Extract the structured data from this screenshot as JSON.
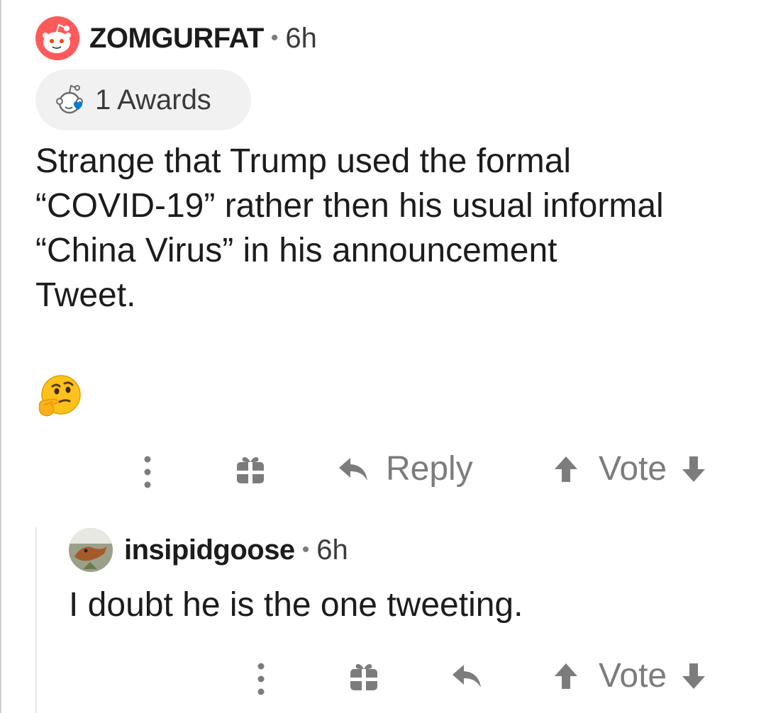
{
  "parent": {
    "username": "ZOMGURFAT",
    "separator": "•",
    "time": "6h",
    "awards_label": "1 Awards",
    "body": "Strange that Trump used the formal\n“COVID-19” rather then his usual informal\n“China Virus” in his announcement\nTweet.",
    "emoji": "thinking-face",
    "actions": {
      "more": "more-options",
      "gift": "award-gift",
      "reply_label": "Reply",
      "vote_label": "Vote"
    }
  },
  "reply": {
    "username": "insipidgoose",
    "separator": "•",
    "time": "6h",
    "body": "I doubt he is the one tweeting.",
    "actions": {
      "vote_label": "Vote"
    }
  },
  "colors": {
    "text": "#1c1c1c",
    "muted": "#7c7c7c",
    "avatar_red": "#ff5a5a",
    "award_blue": "#0079d3",
    "pill_bg": "#f1f1f1"
  }
}
